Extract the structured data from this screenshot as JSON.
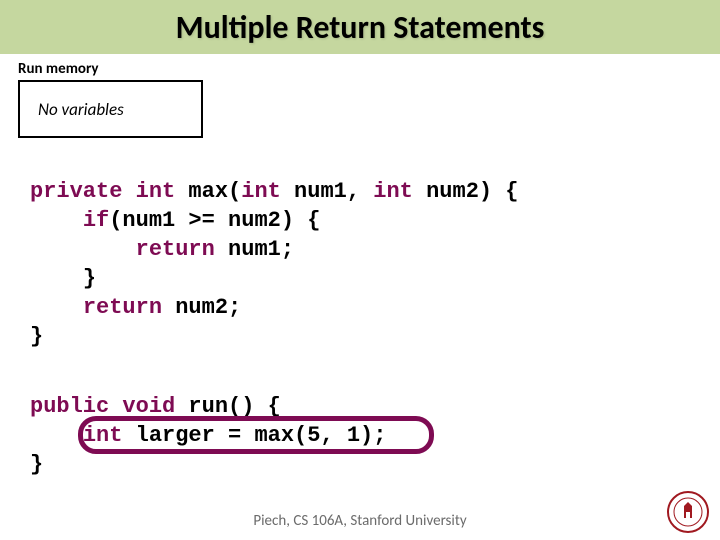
{
  "title": "Multiple Return Statements",
  "memory": {
    "label": "Run memory",
    "content": "No variables"
  },
  "code": {
    "max": {
      "sig_kw1": "private",
      "sig_kw2": "int",
      "sig_name": " max(",
      "sig_kw3": "int",
      "sig_mid": " num1, ",
      "sig_kw4": "int",
      "sig_end": " num2) {",
      "if_kw": "if",
      "if_cond": "(num1 >= num2) {",
      "ret1_kw": "return",
      "ret1_rest": " num1;",
      "close1": "}",
      "ret2_kw": "return",
      "ret2_rest": " num2;",
      "close2": "}"
    },
    "run": {
      "sig_kw1": "public",
      "sig_kw2": "void",
      "sig_name": " run() {",
      "body_kw": "int",
      "body_rest": " larger = max(5, 1);",
      "close": "}"
    }
  },
  "footer": "Piech, CS 106A, Stanford University"
}
